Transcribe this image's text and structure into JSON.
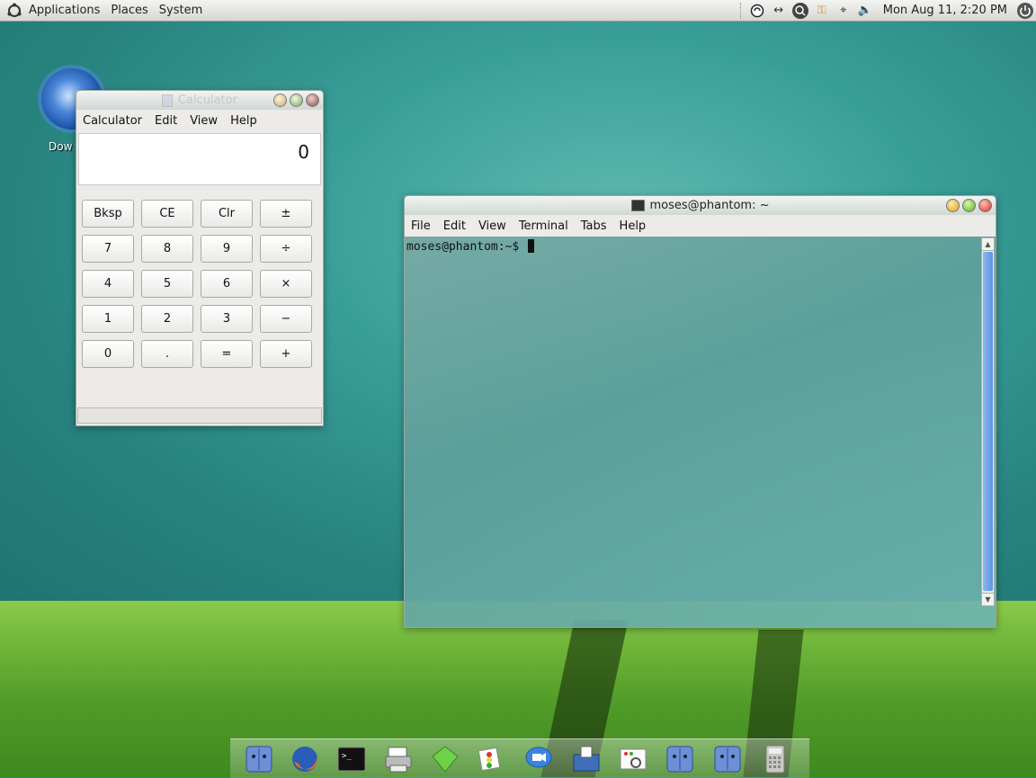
{
  "panel": {
    "menus": [
      "Applications",
      "Places",
      "System"
    ],
    "clock": "Mon Aug 11,  2:20 PM"
  },
  "desktop_icon": {
    "label": "Dow",
    "icon": "download-globe-icon"
  },
  "calculator": {
    "title": "Calculator",
    "menus": [
      "Calculator",
      "Edit",
      "View",
      "Help"
    ],
    "display": "0",
    "keys": [
      "Bksp",
      "CE",
      "Clr",
      "±",
      "7",
      "8",
      "9",
      "÷",
      "4",
      "5",
      "6",
      "×",
      "1",
      "2",
      "3",
      "−",
      "0",
      ".",
      "=",
      "+"
    ]
  },
  "terminal": {
    "title": "moses@phantom: ~",
    "menus": [
      "File",
      "Edit",
      "View",
      "Terminal",
      "Tabs",
      "Help"
    ],
    "prompt": "moses@phantom:~$ "
  },
  "dock": {
    "items": [
      "finder-icon",
      "firefox-icon",
      "terminal-icon",
      "printer-icon",
      "gem-icon",
      "mail-stamps-icon",
      "chat-icon",
      "screen-icon",
      "screenshot-icon",
      "finder-icon",
      "finder-icon",
      "calculator-icon"
    ]
  },
  "colors": {
    "accent": "#5b95e3",
    "desktop": "#2f8f8a"
  }
}
